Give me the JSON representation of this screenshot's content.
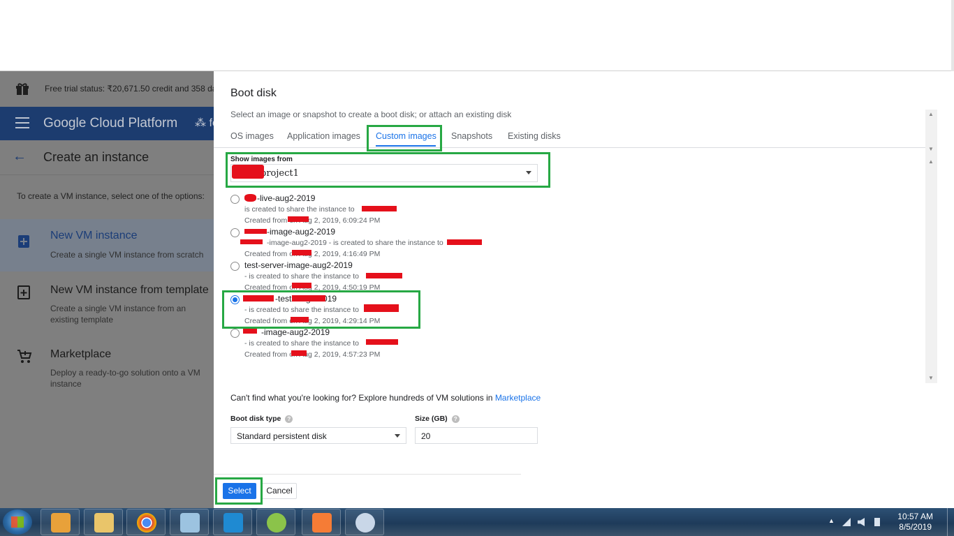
{
  "gcp": {
    "trial_status": "Free trial status: ₹20,671.50 credit and 358 da",
    "brand": "Google Cloud Platform",
    "project_short": "fe",
    "page_title": "Create an instance",
    "intro": "To create a VM instance, select one of the options:",
    "options": [
      {
        "title": "New VM instance",
        "desc": "Create a single VM instance from scratch"
      },
      {
        "title": "New VM instance from template",
        "desc": "Create a single VM instance from an existing template"
      },
      {
        "title": "Marketplace",
        "desc": "Deploy a ready-to-go solution onto a VM instance"
      }
    ]
  },
  "dialog": {
    "title": "Boot disk",
    "subtitle": "Select an image or snapshot to create a boot disk; or attach an existing disk",
    "tabs": [
      "OS images",
      "Application images",
      "Custom images",
      "Snapshots",
      "Existing disks"
    ],
    "active_tab": "Custom images",
    "show_images_label": "Show images from",
    "show_images_value": "project1",
    "images": [
      {
        "name": "-live-aug2-2019",
        "line2": "is created to share the instance to",
        "line3": "Created from on Aug 2, 2019, 6:09:24 PM",
        "selected": false
      },
      {
        "name": "-image-aug2-2019",
        "line2": "-image-aug2-2019 - is created to share the instance to",
        "line3": "Created from on Aug 2, 2019, 4:16:49 PM",
        "selected": false
      },
      {
        "name": "test-server-image-aug2-2019",
        "line2": "- is created to share the instance to",
        "line3": "Created from on Aug 2, 2019, 4:50:19 PM",
        "selected": false
      },
      {
        "name": "-test- aug2-2019",
        "line2": "- is created to share the instance to",
        "line3": "Created from on Aug 2, 2019, 4:29:14 PM",
        "selected": true
      },
      {
        "name": "-image-aug2-2019",
        "line2": "- is created to share the instance to",
        "line3": "Created from on Aug 2, 2019, 4:57:23 PM",
        "selected": false
      }
    ],
    "marketplace_text": "Can't find what you're looking for? Explore hundreds of VM solutions in",
    "marketplace_link": "Marketplace",
    "boot_disk_type_label": "Boot disk type",
    "boot_disk_type_value": "Standard persistent disk",
    "size_label": "Size (GB)",
    "size_value": "20",
    "select_button": "Select",
    "cancel_button": "Cancel"
  },
  "taskbar": {
    "time": "10:57 AM",
    "date": "8/5/2019",
    "apps": [
      "media-player-icon",
      "file-explorer-icon",
      "chrome-icon",
      "notepad-icon",
      "vscode-icon",
      "app-icon",
      "xampp-icon",
      "paint-icon"
    ]
  },
  "colors": {
    "accent": "#1a73e8",
    "highlight": "#27a844",
    "redaction": "#e5101b",
    "gcp_bar": "#1c3c6f"
  }
}
